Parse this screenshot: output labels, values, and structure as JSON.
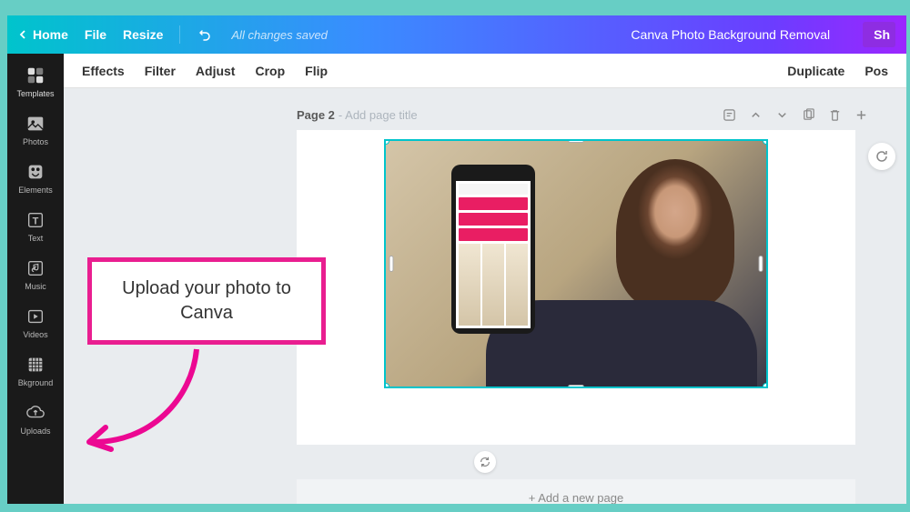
{
  "topbar": {
    "home": "Home",
    "file": "File",
    "resize": "Resize",
    "save_status": "All changes saved",
    "doc_title": "Canva Photo Background Removal",
    "share": "Sh"
  },
  "sidebar": {
    "items": [
      {
        "label": "Templates"
      },
      {
        "label": "Photos"
      },
      {
        "label": "Elements"
      },
      {
        "label": "Text"
      },
      {
        "label": "Music"
      },
      {
        "label": "Videos"
      },
      {
        "label": "Bkground"
      },
      {
        "label": "Uploads"
      }
    ]
  },
  "toolbar": {
    "effects": "Effects",
    "filter": "Filter",
    "adjust": "Adjust",
    "crop": "Crop",
    "flip": "Flip",
    "duplicate": "Duplicate",
    "position": "Pos"
  },
  "page": {
    "label": "Page 2",
    "title_placeholder": "- Add page title",
    "add_new": "+ Add a new page"
  },
  "annotation": {
    "text": "Upload your photo to Canva"
  }
}
